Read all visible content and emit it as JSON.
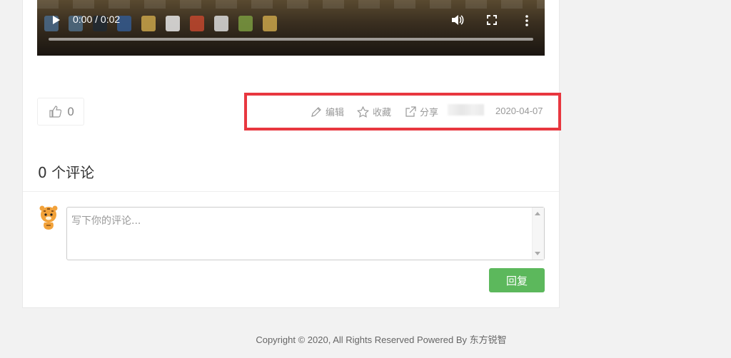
{
  "video": {
    "time_display": "0:00 / 0:02",
    "icons": [
      "play-icon",
      "volume-icon",
      "fullscreen-icon",
      "more-vert-icon"
    ]
  },
  "article": {
    "like_count": "0",
    "actions": {
      "edit_label": "编辑",
      "favorite_label": "收藏",
      "share_label": "分享"
    },
    "date": "2020-04-07"
  },
  "comments": {
    "title": "0 个评论",
    "input_placeholder": "写下你的评论...",
    "reply_label": "回复"
  },
  "footer": {
    "copyright": "Copyright © 2020, All Rights Reserved Powered By 东方锐智"
  },
  "colors": {
    "accent_green": "#5cb85c",
    "highlight_red": "#e8373f"
  }
}
